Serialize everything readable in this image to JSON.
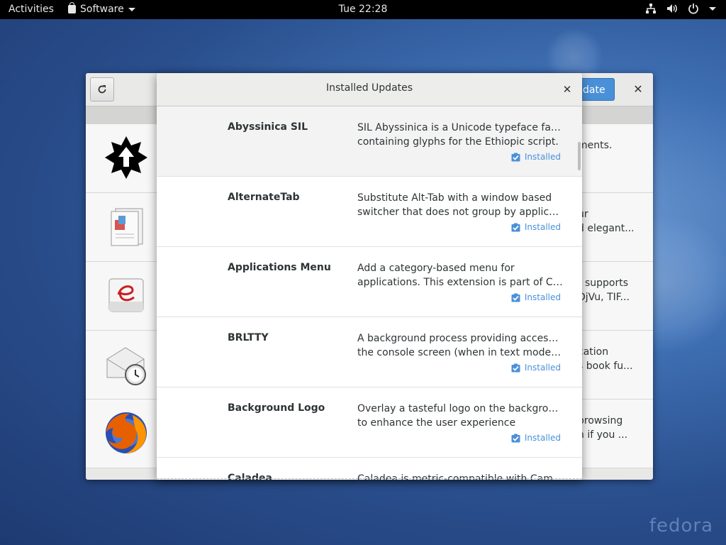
{
  "topbar": {
    "activities": "Activities",
    "app_menu": "Software",
    "clock": "Tue 22:28",
    "icons": [
      "network-icon",
      "volume-icon",
      "power-icon",
      "chevron-down-icon"
    ]
  },
  "background_window": {
    "update_button_partial": "date",
    "rows": [
      {
        "icon": "upload-star-icon",
        "tail_lines": [
          "ments.",
          ""
        ]
      },
      {
        "icon": "documents-icon",
        "tail_lines": [
          "ur",
          "d elegant..."
        ]
      },
      {
        "icon": "document-viewer-icon",
        "tail_lines": [
          "t supports",
          "DjVu, TIF..."
        ]
      },
      {
        "icon": "mail-clock-icon",
        "tail_lines": [
          "cation",
          "s book fu..."
        ]
      },
      {
        "icon": "firefox-icon",
        "tail_lines": [
          "browsing",
          "n if you ..."
        ]
      }
    ]
  },
  "dialog": {
    "title": "Installed Updates",
    "updates": [
      {
        "name": "Abyssinica SIL",
        "desc_lines": [
          "SIL Abyssinica is a Unicode typeface family",
          "containing glyphs for the Ethiopic script."
        ],
        "status": "Installed"
      },
      {
        "name": "AlternateTab",
        "desc_lines": [
          "Substitute Alt-Tab with a window based",
          "switcher that does not group by application..."
        ],
        "status": "Installed"
      },
      {
        "name": "Applications Menu",
        "desc_lines": [
          "Add a category-based menu for",
          "applications. This extension is part of Classi..."
        ],
        "status": "Installed"
      },
      {
        "name": "BRLTTY",
        "desc_lines": [
          "A background process providing access to",
          "the console screen (when in text mode) fo..."
        ],
        "status": "Installed"
      },
      {
        "name": "Background Logo",
        "desc_lines": [
          "Overlay a tasteful logo on the background",
          "to enhance the user experience"
        ],
        "status": "Installed"
      },
      {
        "name": "Caladea",
        "desc_lines": [
          "Caladea is metric-compatible with Cambria",
          ""
        ],
        "status": ""
      }
    ]
  },
  "branding": {
    "watermark": "fedora"
  },
  "colors": {
    "accent": "#4a90d9",
    "topbar": "#000000"
  }
}
